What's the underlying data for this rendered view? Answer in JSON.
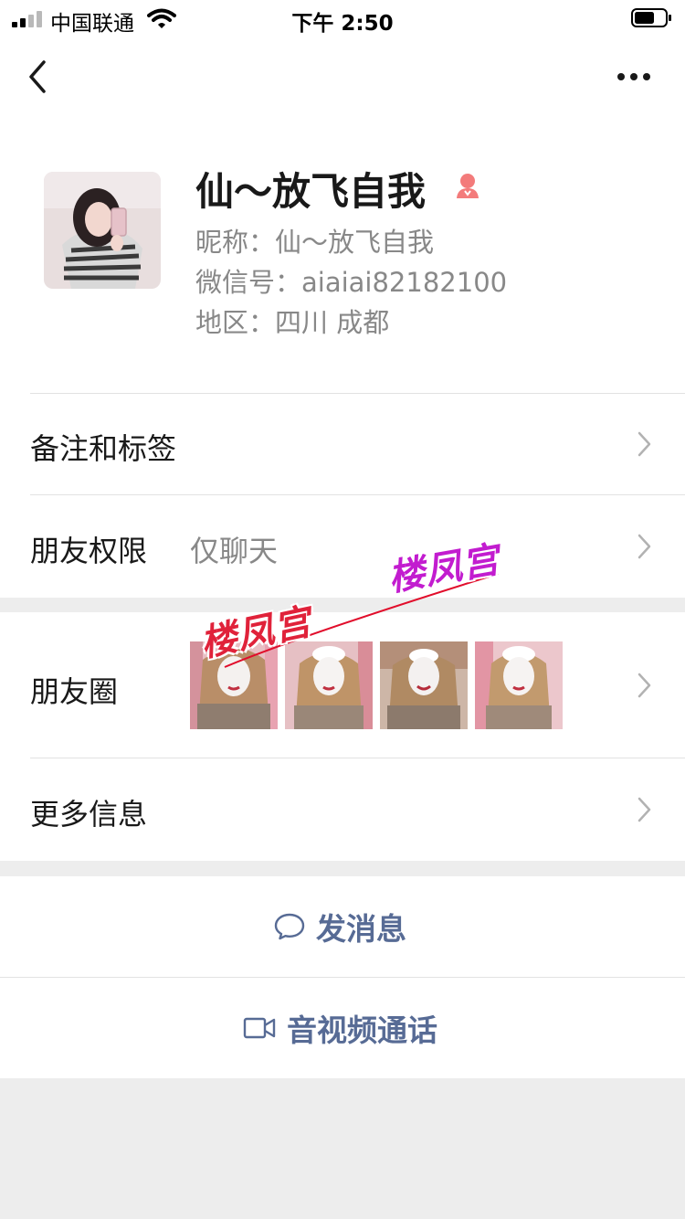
{
  "status_bar": {
    "carrier": "中国联通",
    "time": "下午 2:50"
  },
  "profile": {
    "display_name": "仙～放飞自我",
    "nickname_line": "昵称：仙～放飞自我",
    "wechat_id_line": "微信号：aiaiai82182100",
    "region_line": "地区：四川 成都",
    "gender_icon": "female-icon"
  },
  "cells": {
    "remarks_label": "备注和标签",
    "permission_label": "朋友权限",
    "permission_value": "仅聊天",
    "moments_label": "朋友圈",
    "more_info_label": "更多信息"
  },
  "watermarks": {
    "left": "楼凤宫",
    "right": "楼凤宫"
  },
  "actions": {
    "message_label": "发消息",
    "call_label": "音视频通话"
  },
  "colors": {
    "link": "#576b95",
    "background": "#ededed",
    "gender": "#f37b7b"
  }
}
